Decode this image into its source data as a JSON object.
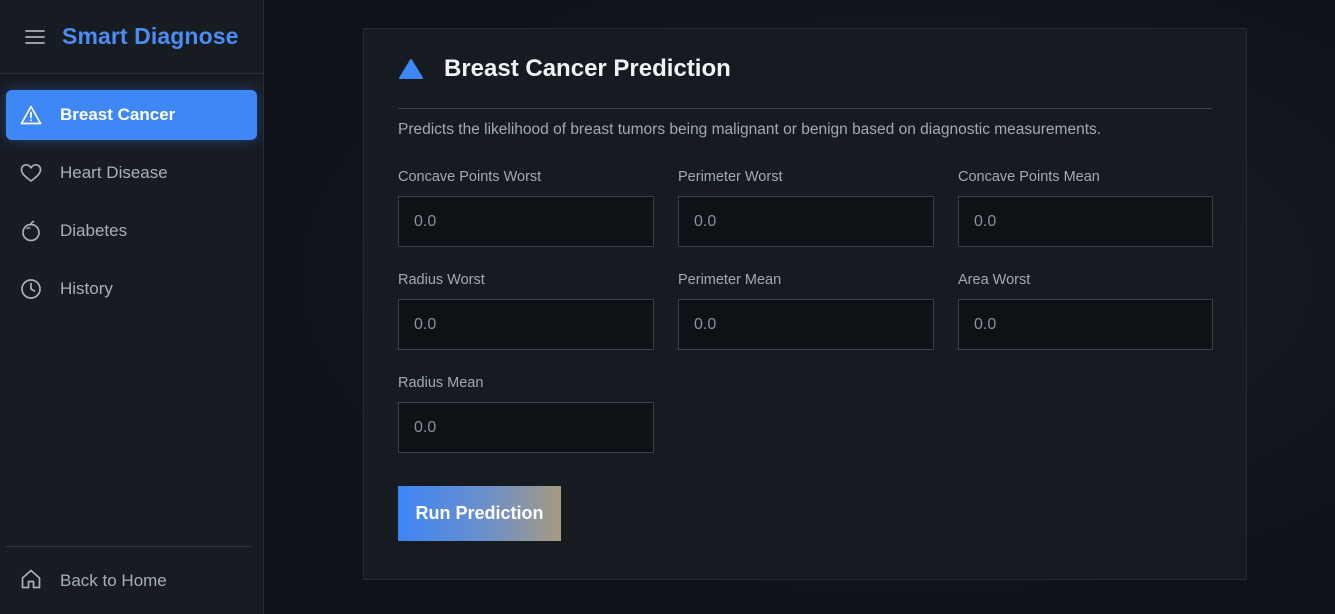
{
  "app": {
    "brand": "Smart Diagnose"
  },
  "sidebar": {
    "items": [
      {
        "label": "Breast Cancer",
        "icon": "warning-triangle-icon",
        "active": true
      },
      {
        "label": "Heart Disease",
        "icon": "heart-icon",
        "active": false
      },
      {
        "label": "Diabetes",
        "icon": "apple-icon",
        "active": false
      },
      {
        "label": "History",
        "icon": "clock-icon",
        "active": false
      }
    ],
    "footer": {
      "label": "Back to Home",
      "icon": "home-icon"
    }
  },
  "card": {
    "title": "Breast Cancer Prediction",
    "icon": "triangle-icon",
    "description": "Predicts the likelihood of breast tumors being malignant or benign based on diagnostic measurements.",
    "fields": [
      {
        "label": "Concave Points Worst",
        "placeholder": "0.0"
      },
      {
        "label": "Perimeter Worst",
        "placeholder": "0.0"
      },
      {
        "label": "Concave Points Mean",
        "placeholder": "0.0"
      },
      {
        "label": "Radius Worst",
        "placeholder": "0.0"
      },
      {
        "label": "Perimeter Mean",
        "placeholder": "0.0"
      },
      {
        "label": "Area Worst",
        "placeholder": "0.0"
      },
      {
        "label": "Radius Mean",
        "placeholder": "0.0"
      }
    ],
    "submit_label": "Run Prediction"
  },
  "colors": {
    "accent": "#3e87f6",
    "brand": "#4b8cf5",
    "background": "#0e1117",
    "sidebar": "#171b22"
  }
}
